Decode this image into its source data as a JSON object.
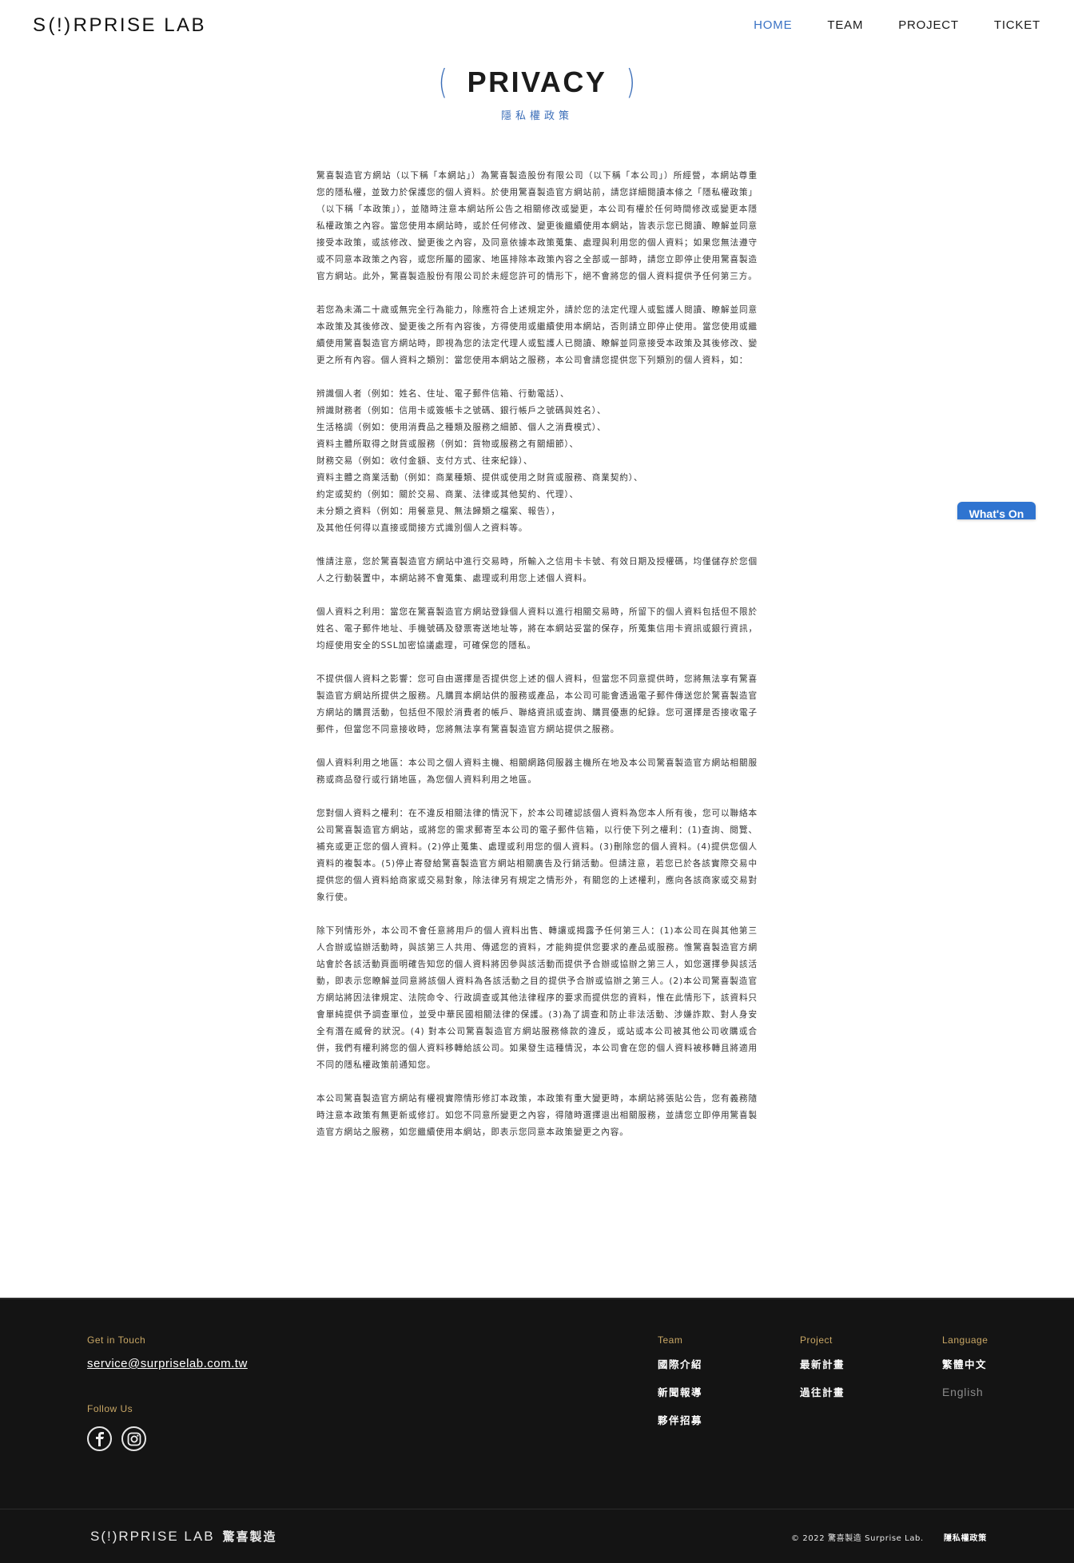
{
  "header": {
    "logo": {
      "before": "S",
      "bang": "(!)",
      "after": "RPRISE LAB"
    },
    "nav": [
      {
        "label": "HOME",
        "active": true
      },
      {
        "label": "TEAM",
        "active": false
      },
      {
        "label": "PROJECT",
        "active": false
      },
      {
        "label": "TICKET",
        "active": false
      }
    ]
  },
  "page": {
    "title": "PRIVACY",
    "subtitle": "隱私權政策",
    "accent_color": "#3a6db8"
  },
  "content": {
    "p1": "驚喜製造官方網站（以下稱「本網站」）為驚喜製造股份有限公司（以下稱「本公司」）所經營，本網站尊重您的隱私權，並致力於保護您的個人資料。於使用驚喜製造官方網站前，請您詳細閱讀本條之「隱私權政策」（以下稱「本政策」），並隨時注意本網站所公告之相關修改或變更，本公司有權於任何時間修改或變更本隱私權政策之內容。當您使用本網站時，或於任何修改、變更後繼續使用本網站，皆表示您已閱讀、瞭解並同意接受本政策，或該修改、變更後之內容，及同意依據本政策蒐集、處理與利用您的個人資料；如果您無法遵守或不同意本政策之內容，或您所屬的國家、地區排除本政策內容之全部或一部時，請您立即停止使用驚喜製造官方網站。此外，驚喜製造股份有限公司於未經您許可的情形下，絕不會將您的個人資料提供予任何第三方。",
    "p2": "若您為未滿二十歲或無完全行為能力，除應符合上述規定外，請於您的法定代理人或監護人閱讀、瞭解並同意本政策及其後修改、變更後之所有內容後，方得使用或繼續使用本網站，否則請立即停止使用。當您使用或繼續使用驚喜製造官方網站時，即視為您的法定代理人或監護人已閱讀、瞭解並同意接受本政策及其後修改、變更之所有內容。個人資料之類別：當您使用本網站之服務，本公司會請您提供您下列類別的個人資料，如：",
    "list": [
      "辨識個人者（例如：姓名、住址、電子郵件信箱、行動電話）、",
      "辨識財務者（例如：信用卡或簽帳卡之號碼、銀行帳戶之號碼與姓名）、",
      "生活格調（例如：使用消費品之種類及服務之細節、個人之消費模式）、",
      "資料主體所取得之財貨或服務（例如：貨物或服務之有關細節）、",
      "財務交易（例如：收付金額、支付方式、往來紀錄）、",
      "資料主體之商業活動（例如：商業種類、提供或使用之財貨或服務、商業契約）、",
      "約定或契約（例如：關於交易、商業、法律或其他契約、代理）、",
      "未分類之資料（例如：用餐意見、無法歸類之檔案、報告），",
      "及其他任何得以直接或間接方式識別個人之資料等。"
    ],
    "p3": "惟請注意，您於驚喜製造官方網站中進行交易時，所輸入之信用卡卡號、有效日期及授權碼，均僅儲存於您個人之行動裝置中，本網站將不會蒐集、處理或利用您上述個人資料。",
    "p4": "個人資料之利用：當您在驚喜製造官方網站登錄個人資料以進行相關交易時，所留下的個人資料包括但不限於姓名、電子郵件地址、手機號碼及發票寄送地址等，將在本網站妥當的保存，所蒐集信用卡資訊或銀行資訊，均經使用安全的SSL加密協議處理，可確保您的隱私。",
    "p5": "不提供個人資料之影響：您可自由選擇是否提供您上述的個人資料，但當您不同意提供時，您將無法享有驚喜製造官方網站所提供之服務。凡購買本網站供的服務或產品，本公司可能會透過電子郵件傳送您於驚喜製造官方網站的購買活動，包括但不限於消費者的帳戶、聯絡資訊或查詢、購買優惠的紀錄。您可選擇是否接收電子郵件，但當您不同意接收時，您將無法享有驚喜製造官方網站提供之服務。",
    "p6": "個人資料利用之地區：本公司之個人資料主機、相關網路伺服器主機所在地及本公司驚喜製造官方網站相關服務或商品發行或行銷地區，為您個人資料利用之地區。",
    "p7": "您對個人資料之權利：在不違反相關法律的情況下，於本公司確認該個人資料為您本人所有後，您可以聯絡本公司驚喜製造官方網站，或將您的需求郵寄至本公司的電子郵件信箱，以行使下列之權利：(1)查詢、閱覽、補充或更正您的個人資料。(2)停止蒐集、處理或利用您的個人資料。(3)刪除您的個人資料。(4)提供您個人資料的複製本。(5)停止寄發給驚喜製造官方網站相關廣告及行銷活動。但請注意，若您已於各該實際交易中提供您的個人資料給商家或交易對象，除法律另有規定之情形外，有關您的上述權利，應向各該商家或交易對象行使。",
    "p8": "除下列情形外，本公司不會任意將用戶的個人資料出售、轉讓或揭露予任何第三人：(1)本公司在與其他第三人合辦或協辦活動時，與該第三人共用、傳遞您的資料，才能夠提供您要求的產品或服務。惟驚喜製造官方網站會於各該活動頁面明確告知您的個人資料將因參與該活動而提供予合辦或協辦之第三人，如您選擇參與該活動，即表示您瞭解並同意將該個人資料為各該活動之目的提供予合辦或協辦之第三人。(2)本公司驚喜製造官方網站將因法律規定、法院命令、行政調查或其他法律程序的要求而提供您的資料，惟在此情形下，該資料只會單純提供予調查單位，並受中華民國相關法律的保護。(3)為了調查和防止非法活動、涉嫌詐欺、對人身安全有潛在威脅的狀況。(4) 對本公司驚喜製造官方網站服務條款的違反，或站或本公司被其他公司收購或合併，我們有權利將您的個人資料移轉給該公司。如果發生這種情況，本公司會在您的個人資料被移轉且將適用不同的隱私權政策前通知您。",
    "p9": "本公司驚喜製造官方網站有權視實際情形修訂本政策，本政策有重大變更時，本網站將張貼公告，您有義務隨時注意本政策有無更新或修訂。如您不同意所變更之內容，得隨時選擇退出相關服務，並請您立即停用驚喜製造官方網站之服務，如您繼續使用本網站，即表示您同意本政策變更之內容。"
  },
  "widget": {
    "label": "What's On",
    "color": "#2f74d0"
  },
  "footer": {
    "get_in_touch_label": "Get in Touch",
    "email": "service@surpriselab.com.tw",
    "follow_us_label": "Follow Us",
    "social": [
      "facebook-icon",
      "instagram-icon"
    ],
    "team": {
      "label": "Team",
      "links": [
        "國際介紹",
        "新聞報導",
        "夥伴招募"
      ]
    },
    "project": {
      "label": "Project",
      "links": [
        "最新計畫",
        "過往計畫"
      ]
    },
    "language": {
      "label": "Language",
      "current": "繁體中文",
      "other": "English"
    },
    "bottom_logo": "S(!)RPRISE LAB",
    "bottom_logo_zh": "驚喜製造",
    "copyright": "© 2022 驚喜製造 Surprise Lab.",
    "policy_link": "隱私權政策",
    "accent_color": "#c9a765"
  }
}
